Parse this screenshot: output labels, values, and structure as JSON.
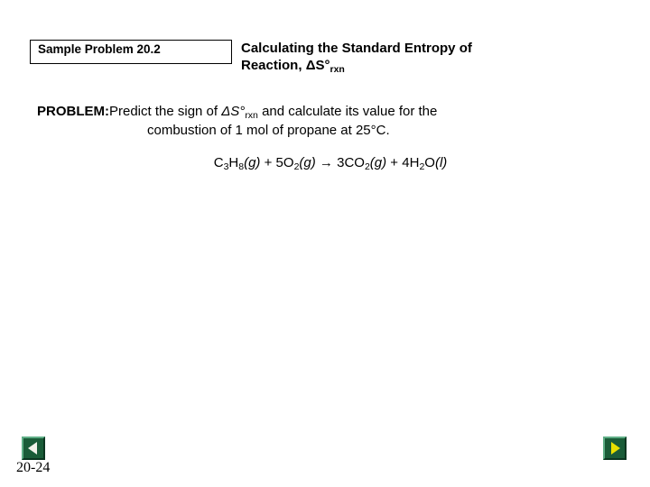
{
  "slide": {
    "sample_problem_label": "Sample Problem 20.2",
    "title_line1": "Calculating the Standard Entropy of",
    "title_line2_prefix": "Reaction, ",
    "title_line2_delta": "ΔS°",
    "title_line2_sub": "rxn",
    "problem_label": "PROBLEM:",
    "problem_text_1": "Predict the sign of ",
    "problem_delta": "ΔS°",
    "problem_sub": "rxn",
    "problem_text_2": " and calculate its value for the",
    "problem_line2": "combustion of 1 mol of propane at 25°C.",
    "equation": {
      "reactant1": {
        "formula_c": "C",
        "c_sub": "3",
        "formula_h": "H",
        "h_sub": "8",
        "state": "(g)"
      },
      "plus": " + ",
      "reactant2": {
        "coeff": "5",
        "formula": "O",
        "sub": "2",
        "state": "(g)"
      },
      "arrow": " →  ",
      "product1": {
        "coeff": "3",
        "formula_c": "C",
        "formula_o": "O",
        "sub": "2",
        "state": "(g)"
      },
      "plus2": " + ",
      "product2": {
        "coeff": "4",
        "formula_h": "H",
        "h_sub": "2",
        "formula_o": "O",
        "state": "(l)"
      }
    },
    "page_number": "20-24",
    "nav": {
      "prev_label": "previous-slide",
      "next_label": "next-slide"
    },
    "colors": {
      "nav_button_fill": "#1a5c38",
      "nav_prev_arrow": "#f2f2ea",
      "nav_next_arrow": "#e8e000",
      "text": "#000000",
      "background": "#ffffff"
    }
  }
}
